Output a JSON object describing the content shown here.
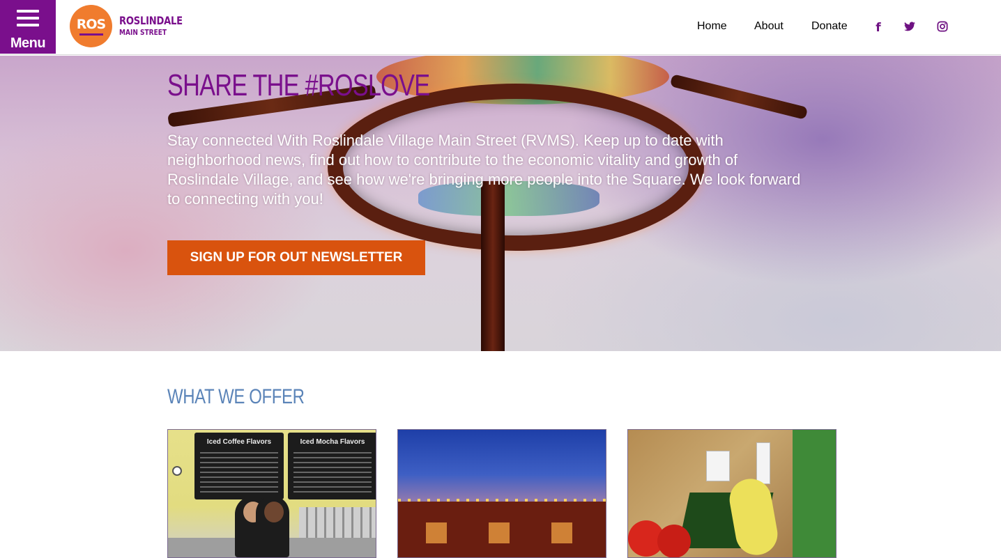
{
  "header": {
    "menu_label": "Menu",
    "logo": {
      "mark": "ROS",
      "line1": "ROSLINDALE",
      "line2": "MAIN STREET"
    },
    "nav": [
      {
        "label": "Home"
      },
      {
        "label": "About"
      },
      {
        "label": "Donate"
      }
    ],
    "social": [
      {
        "icon": "facebook-icon",
        "glyph": "f"
      },
      {
        "icon": "twitter-icon",
        "glyph": "🐦"
      },
      {
        "icon": "instagram-icon",
        "glyph": "◎"
      }
    ]
  },
  "hero": {
    "title": "SHARE THE #ROSLOVE",
    "text": "Stay connected With Roslindale Village Main Street (RVMS). Keep up to date with neighborhood news, find out how to contribute to the economic vitality and growth of Roslindale Village, and see how we're bringing more people into the Square. We look forward to connecting with you!",
    "cta_label": "SIGN UP FOR OUT NEWSLETTER"
  },
  "offers": {
    "title": "WHAT WE OFFER",
    "boards": [
      "Iced Coffee Flavors",
      "Iced Mocha Flavors"
    ]
  },
  "colors": {
    "brand_purple": "#7a0f8c",
    "brand_orange": "#f07c2e",
    "cta_orange": "#d9530e",
    "offer_blue": "#5b84b8"
  }
}
